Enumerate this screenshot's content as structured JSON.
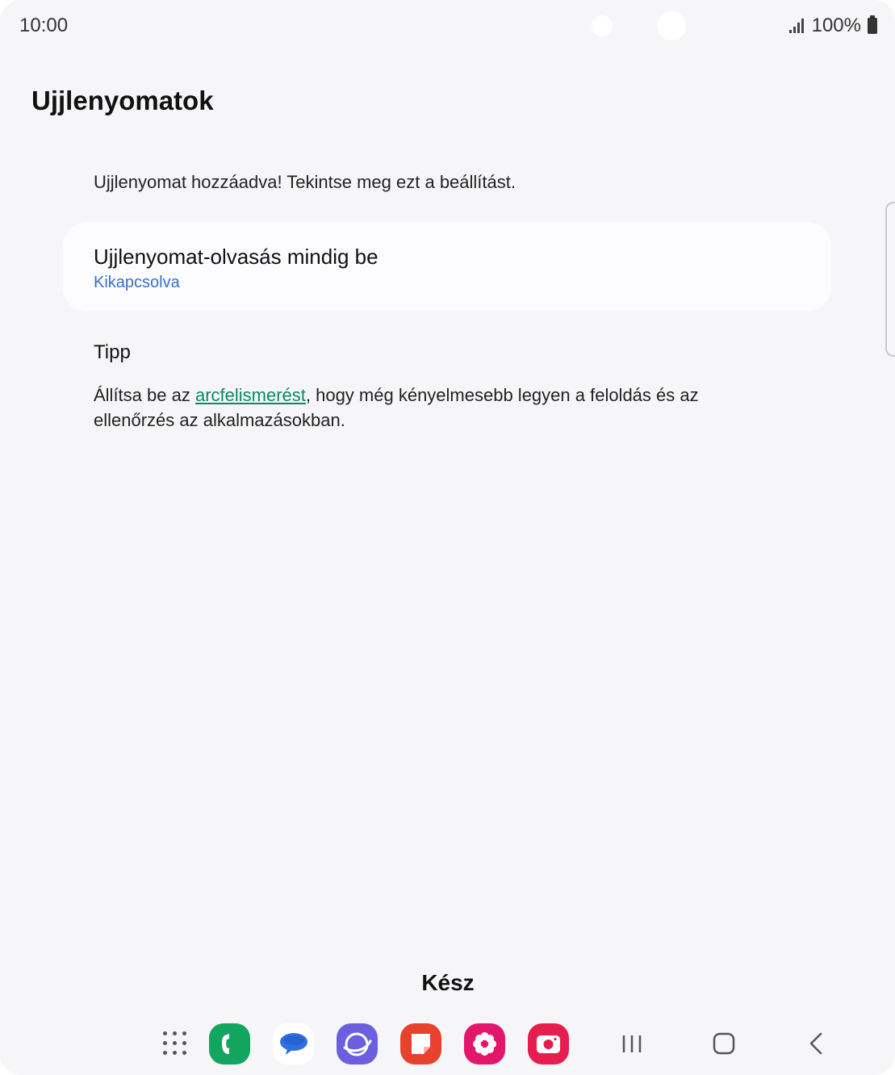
{
  "status_bar": {
    "time": "10:00",
    "battery": "100%",
    "icons": [
      "signal-icon",
      "battery-icon"
    ]
  },
  "page": {
    "title": "Ujjlenyomatok",
    "info": "Ujjlenyomat hozzáadva! Tekintse meg ezt a beállítást."
  },
  "setting": {
    "title": "Ujjlenyomat-olvasás mindig be",
    "status": "Kikapcsolva",
    "status_color": "#3a6fc9"
  },
  "tip": {
    "heading": "Tipp",
    "before_link": "Állítsa be az ",
    "link": "arcfelismerést",
    "after_link": ", hogy még kényelmesebb legyen a feloldás és az ellenőrzés az alkalmazásokban.",
    "link_color": "#0a8a5e"
  },
  "done_button": "Kész",
  "dock": {
    "apps": [
      "apps-grid-icon",
      "phone-icon",
      "messages-icon",
      "internet-icon",
      "notes-icon",
      "gallery-icon",
      "camera-icon"
    ],
    "nav": [
      "recents-icon",
      "home-icon",
      "back-icon"
    ]
  }
}
